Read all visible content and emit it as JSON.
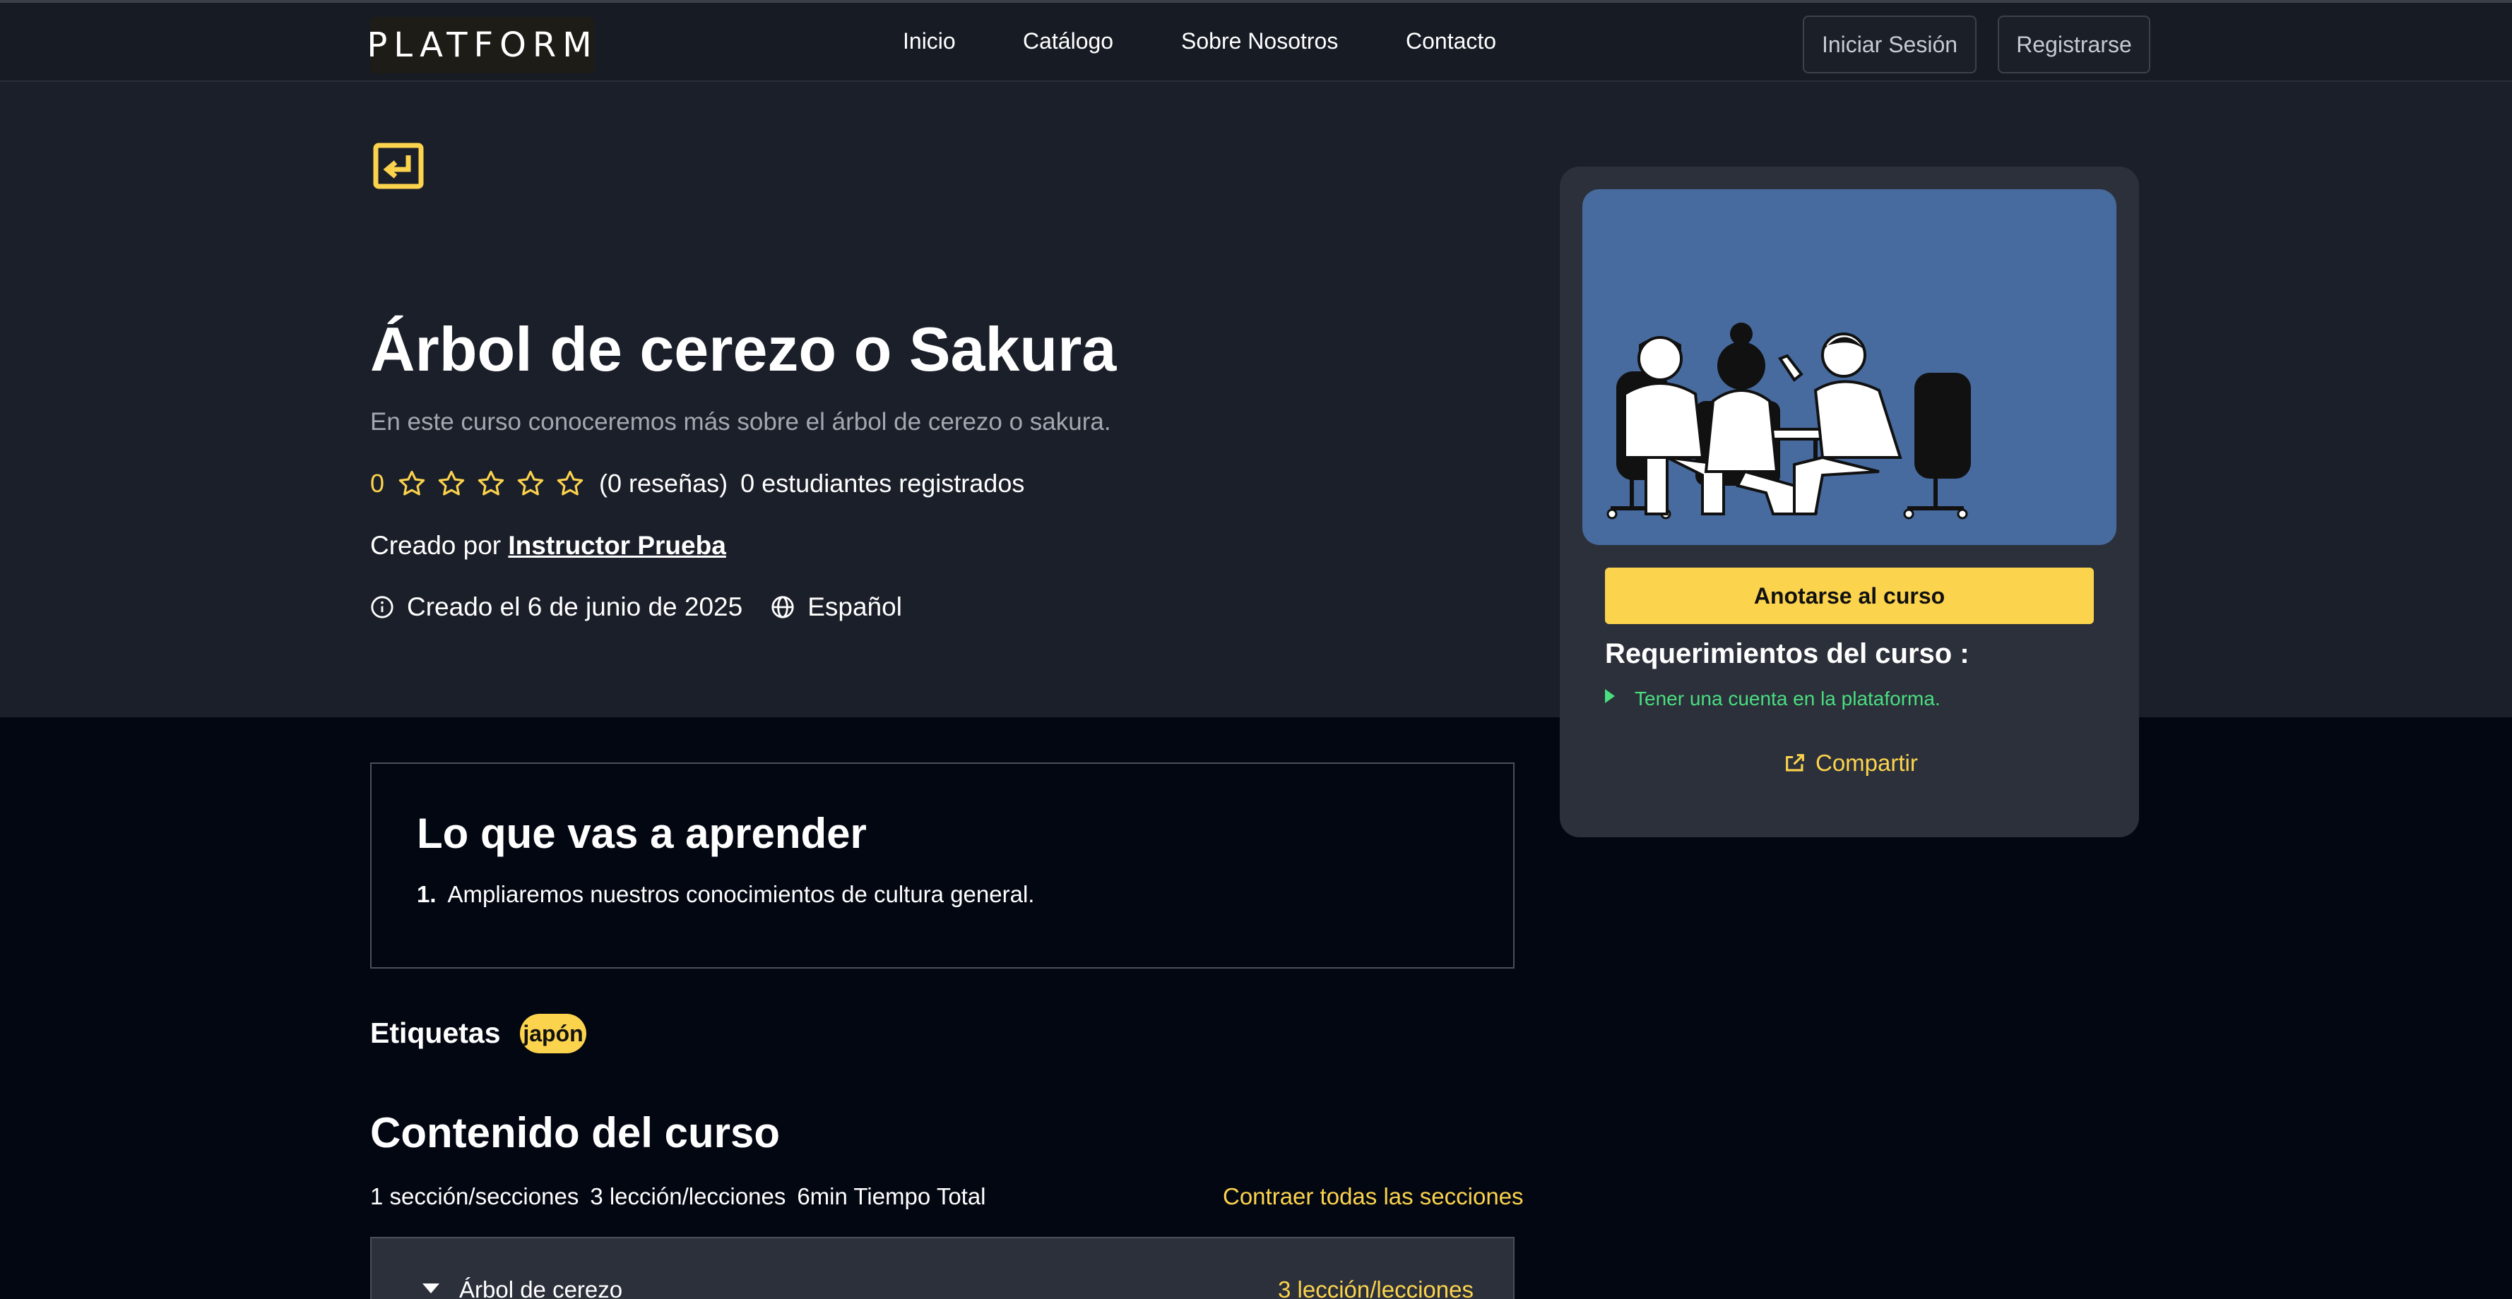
{
  "nav": {
    "logo": "PLATFORM",
    "links": [
      "Inicio",
      "Catálogo",
      "Sobre Nosotros",
      "Contacto"
    ],
    "login": "Iniciar Sesión",
    "register": "Registrarse"
  },
  "course": {
    "title": "Árbol de cerezo o Sakura",
    "subtitle": "En este curso conoceremos más sobre el árbol de cerezo o sakura.",
    "rating": "0",
    "stars": 0,
    "reviews": "(0 reseñas)",
    "students": "0 estudiantes registrados",
    "created_by_label": "Creado por",
    "instructor": "Instructor Prueba",
    "created_date": "Creado el 6 de junio de 2025",
    "language": "Español"
  },
  "card": {
    "enroll": "Anotarse al curso",
    "requirements_title": "Requerimientos del curso :",
    "requirements": [
      "Tener una cuenta en la plataforma."
    ],
    "share": "Compartir"
  },
  "learn": {
    "title": "Lo que vas a aprender",
    "items": [
      {
        "num": "1.",
        "text": "Ampliaremos nuestros conocimientos de cultura general."
      }
    ]
  },
  "tags": {
    "label": "Etiquetas",
    "items": [
      "japón"
    ]
  },
  "content": {
    "title": "Contenido del curso",
    "sections_count": "1 sección/secciones",
    "lessons_count": "3 lección/lecciones",
    "total_time": "6min Tiempo Total",
    "collapse_all": "Contraer todas las secciones",
    "sections": [
      {
        "name": "Árbol de cerezo",
        "count": "3 lección/lecciones"
      }
    ]
  },
  "colors": {
    "accent": "#fcd34d",
    "requirement": "#4ade80",
    "hero_bg": "#1b1f29",
    "page_bg": "#030712",
    "card_bg": "#2b303a",
    "image_bg": "#476b9e"
  }
}
